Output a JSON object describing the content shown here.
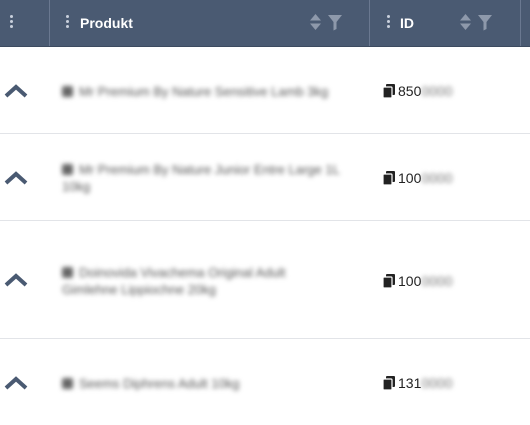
{
  "header": {
    "columns": [
      {
        "label": ""
      },
      {
        "label": "Produkt"
      },
      {
        "label": "ID"
      }
    ]
  },
  "colors": {
    "header_bg": "#4a5a72",
    "icon": "#4a5a72",
    "border": "#e2e4e8"
  },
  "rows": [
    {
      "product": "Mr Premium By Nature Sensitive Lamb 3kg",
      "id_visible": "850",
      "id_hidden": "0000"
    },
    {
      "product": "Mr Premium By Nature Junior Entre Large 1L 10kg",
      "id_visible": "100",
      "id_hidden": "0000"
    },
    {
      "product": "Doinovida Vivachema Original Adult Gimlehne Lippiochne 20kg",
      "id_visible": "100",
      "id_hidden": "0000"
    },
    {
      "product": "Seems Diphrens Adult 10kg",
      "id_visible": "131",
      "id_hidden": "0000"
    }
  ],
  "icons": {
    "expand": "chevron-up-icon",
    "copy": "copy-icon",
    "sort": "sort-icon",
    "filter": "filter-icon",
    "drag": "drag-handle-icon"
  }
}
